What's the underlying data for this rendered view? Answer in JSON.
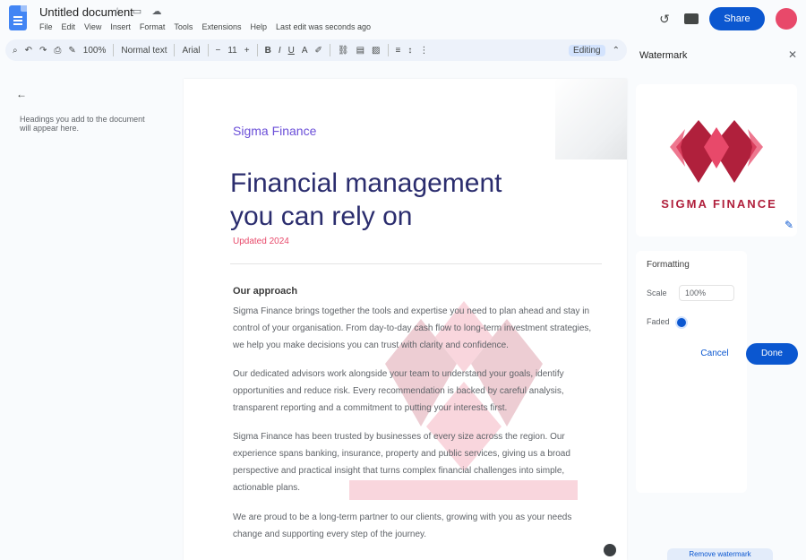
{
  "header": {
    "doc_title": "Untitled document",
    "menu": [
      "File",
      "Edit",
      "View",
      "Insert",
      "Format",
      "Tools",
      "Extensions",
      "Help",
      "Last edit was seconds ago"
    ],
    "share_label": "Share"
  },
  "toolbar": {
    "zoom": "100%",
    "style": "Normal text",
    "font": "Arial",
    "font_size": "11",
    "mode": "Editing"
  },
  "outline": {
    "text": "Headings you add to the document will appear here."
  },
  "page": {
    "brand": "Sigma Finance",
    "headline_line1": "Financial management",
    "headline_line2": "you can rely on",
    "tagline": "Updated 2024",
    "section_heading": "Our approach",
    "paragraphs": [
      "Sigma Finance brings together the tools and expertise you need to plan ahead and stay in control of your organisation. From day-to-day cash flow to long-term investment strategies, we help you make decisions you can trust with clarity and confidence.",
      "Our dedicated advisors work alongside your team to understand your goals, identify opportunities and reduce risk. Every recommendation is backed by careful analysis, transparent reporting and a commitment to putting your interests first.",
      "Sigma Finance has been trusted by businesses of every size across the region. Our experience spans banking, insurance, property and public services, giving us a broad perspective and practical insight that turns complex financial challenges into simple, actionable plans.",
      "We are proud to be a long-term partner to our clients, growing with you as your needs change and supporting every step of the journey."
    ]
  },
  "panel": {
    "title": "Watermark",
    "logo_text": "SIGMA FINANCE",
    "settings_title": "Formatting",
    "scale_label": "Scale",
    "scale_value": "100%",
    "fade_label": "Faded",
    "cancel_label": "Cancel",
    "done_label": "Done",
    "bottom_label": "Remove watermark"
  },
  "colors": {
    "brand_red": "#b0203c",
    "brand_pink": "#e8496a",
    "accent_blue": "#0b57d0",
    "headline_navy": "#2b2d6e"
  }
}
